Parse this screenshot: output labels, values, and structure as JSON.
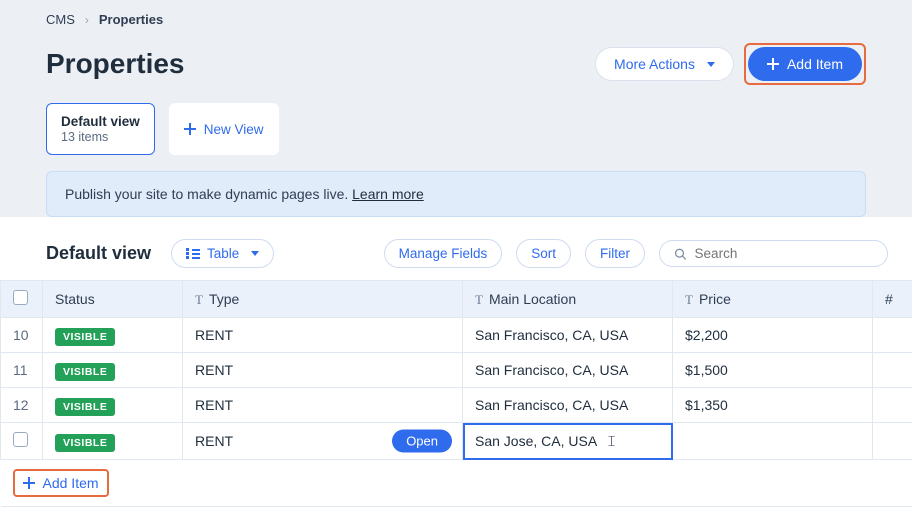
{
  "breadcrumb": {
    "root": "CMS",
    "current": "Properties"
  },
  "page": {
    "title": "Properties"
  },
  "actions": {
    "more": "More Actions",
    "add_item": "Add Item"
  },
  "views": {
    "active": {
      "name": "Default view",
      "sub": "13 items"
    },
    "new_view": "New View"
  },
  "banner": {
    "text": "Publish your site to make dynamic pages live. ",
    "link": "Learn more"
  },
  "controls": {
    "section_title": "Default view",
    "view_mode": "Table",
    "manage_fields": "Manage Fields",
    "sort": "Sort",
    "filter": "Filter",
    "search_placeholder": "Search"
  },
  "columns": {
    "status": "Status",
    "type": "Type",
    "location": "Main Location",
    "price": "Price",
    "hash": "#"
  },
  "status_label": "VISIBLE",
  "open_label": "Open",
  "rows": [
    {
      "num": "10",
      "type": "RENT",
      "location": "San Francisco, CA, USA",
      "price": "$2,200"
    },
    {
      "num": "11",
      "type": "RENT",
      "location": "San Francisco, CA, USA",
      "price": "$1,500"
    },
    {
      "num": "12",
      "type": "RENT",
      "location": "San Francisco, CA, USA",
      "price": "$1,350"
    },
    {
      "num": "",
      "type": "RENT",
      "location": "San Jose, CA, USA",
      "price": ""
    }
  ],
  "footer": {
    "add_item": "Add Item"
  }
}
